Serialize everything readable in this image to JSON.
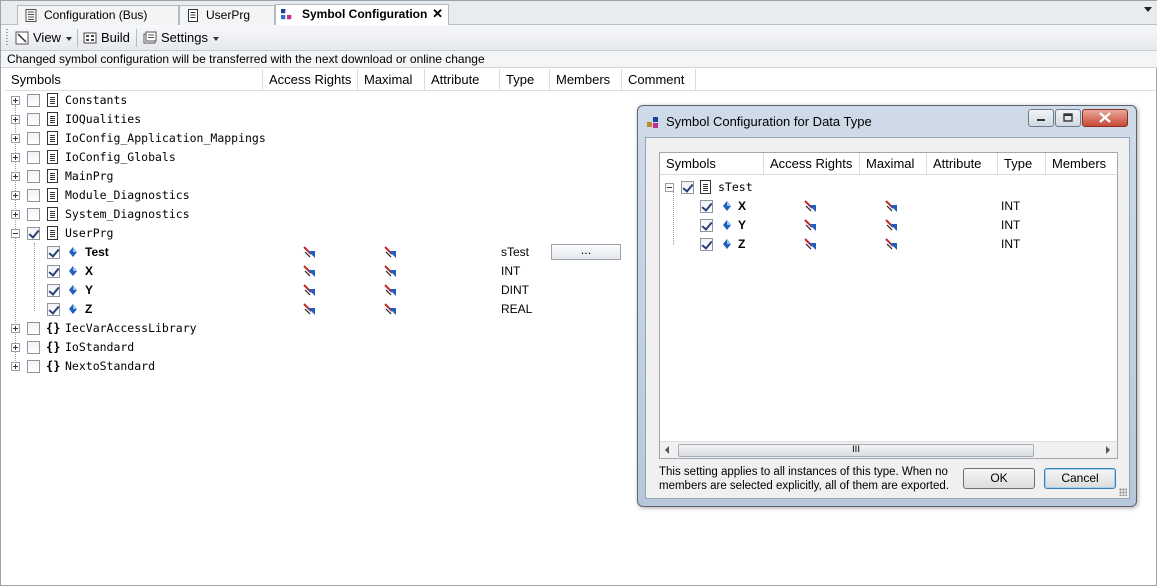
{
  "tabs": [
    {
      "label": "Configuration (Bus)",
      "icon": "device-icon"
    },
    {
      "label": "UserPrg",
      "icon": "document-icon"
    },
    {
      "label": "Symbol Configuration",
      "icon": "symbol-config-icon",
      "active": true
    }
  ],
  "toolbar": {
    "view_label": "View",
    "build_label": "Build",
    "settings_label": "Settings"
  },
  "info_message": "Changed symbol configuration will be transferred with the next download or online change",
  "grid": {
    "columns": [
      "Symbols",
      "Access Rights",
      "Maximal",
      "Attribute",
      "Type",
      "Members",
      "Comment"
    ],
    "rows": [
      {
        "name": "Constants",
        "checked": false,
        "expanded": false,
        "kind": "pou"
      },
      {
        "name": "IOQualities",
        "checked": false,
        "expanded": false,
        "kind": "pou"
      },
      {
        "name": "IoConfig_Application_Mappings",
        "checked": false,
        "expanded": false,
        "kind": "pou"
      },
      {
        "name": "IoConfig_Globals",
        "checked": false,
        "expanded": false,
        "kind": "pou"
      },
      {
        "name": "MainPrg",
        "checked": false,
        "expanded": false,
        "kind": "pou"
      },
      {
        "name": "Module_Diagnostics",
        "checked": false,
        "expanded": false,
        "kind": "pou"
      },
      {
        "name": "System_Diagnostics",
        "checked": false,
        "expanded": false,
        "kind": "pou"
      },
      {
        "name": "UserPrg",
        "checked": true,
        "expanded": true,
        "kind": "pou"
      },
      {
        "name": "Test",
        "checked": true,
        "kind": "var",
        "type": "sTest",
        "members": "..."
      },
      {
        "name": "X",
        "checked": true,
        "kind": "var",
        "type": "INT"
      },
      {
        "name": "Y",
        "checked": true,
        "kind": "var",
        "type": "DINT"
      },
      {
        "name": "Z",
        "checked": true,
        "kind": "var",
        "type": "REAL"
      },
      {
        "name": "IecVarAccessLibrary",
        "checked": false,
        "expanded": false,
        "kind": "library"
      },
      {
        "name": "IoStandard",
        "checked": false,
        "expanded": false,
        "kind": "library"
      },
      {
        "name": "NextoStandard",
        "checked": false,
        "expanded": false,
        "kind": "library"
      }
    ]
  },
  "dialog": {
    "title": "Symbol Configuration for Data Type",
    "columns": [
      "Symbols",
      "Access Rights",
      "Maximal",
      "Attribute",
      "Type",
      "Members"
    ],
    "root": {
      "name": "sTest",
      "checked": true
    },
    "rows": [
      {
        "name": "X",
        "checked": true,
        "type": "INT"
      },
      {
        "name": "Y",
        "checked": true,
        "type": "INT"
      },
      {
        "name": "Z",
        "checked": true,
        "type": "INT"
      }
    ],
    "scroll_thumb": "III",
    "note": "This setting applies to all instances of this type. When no members are selected explicitly, all of them are exported.",
    "ok_label": "OK",
    "cancel_label": "Cancel"
  },
  "colors": {
    "accent_blue": "#1f5fbf",
    "access_red": "#c62b2b",
    "dialog_frame": "#b8c8da"
  }
}
